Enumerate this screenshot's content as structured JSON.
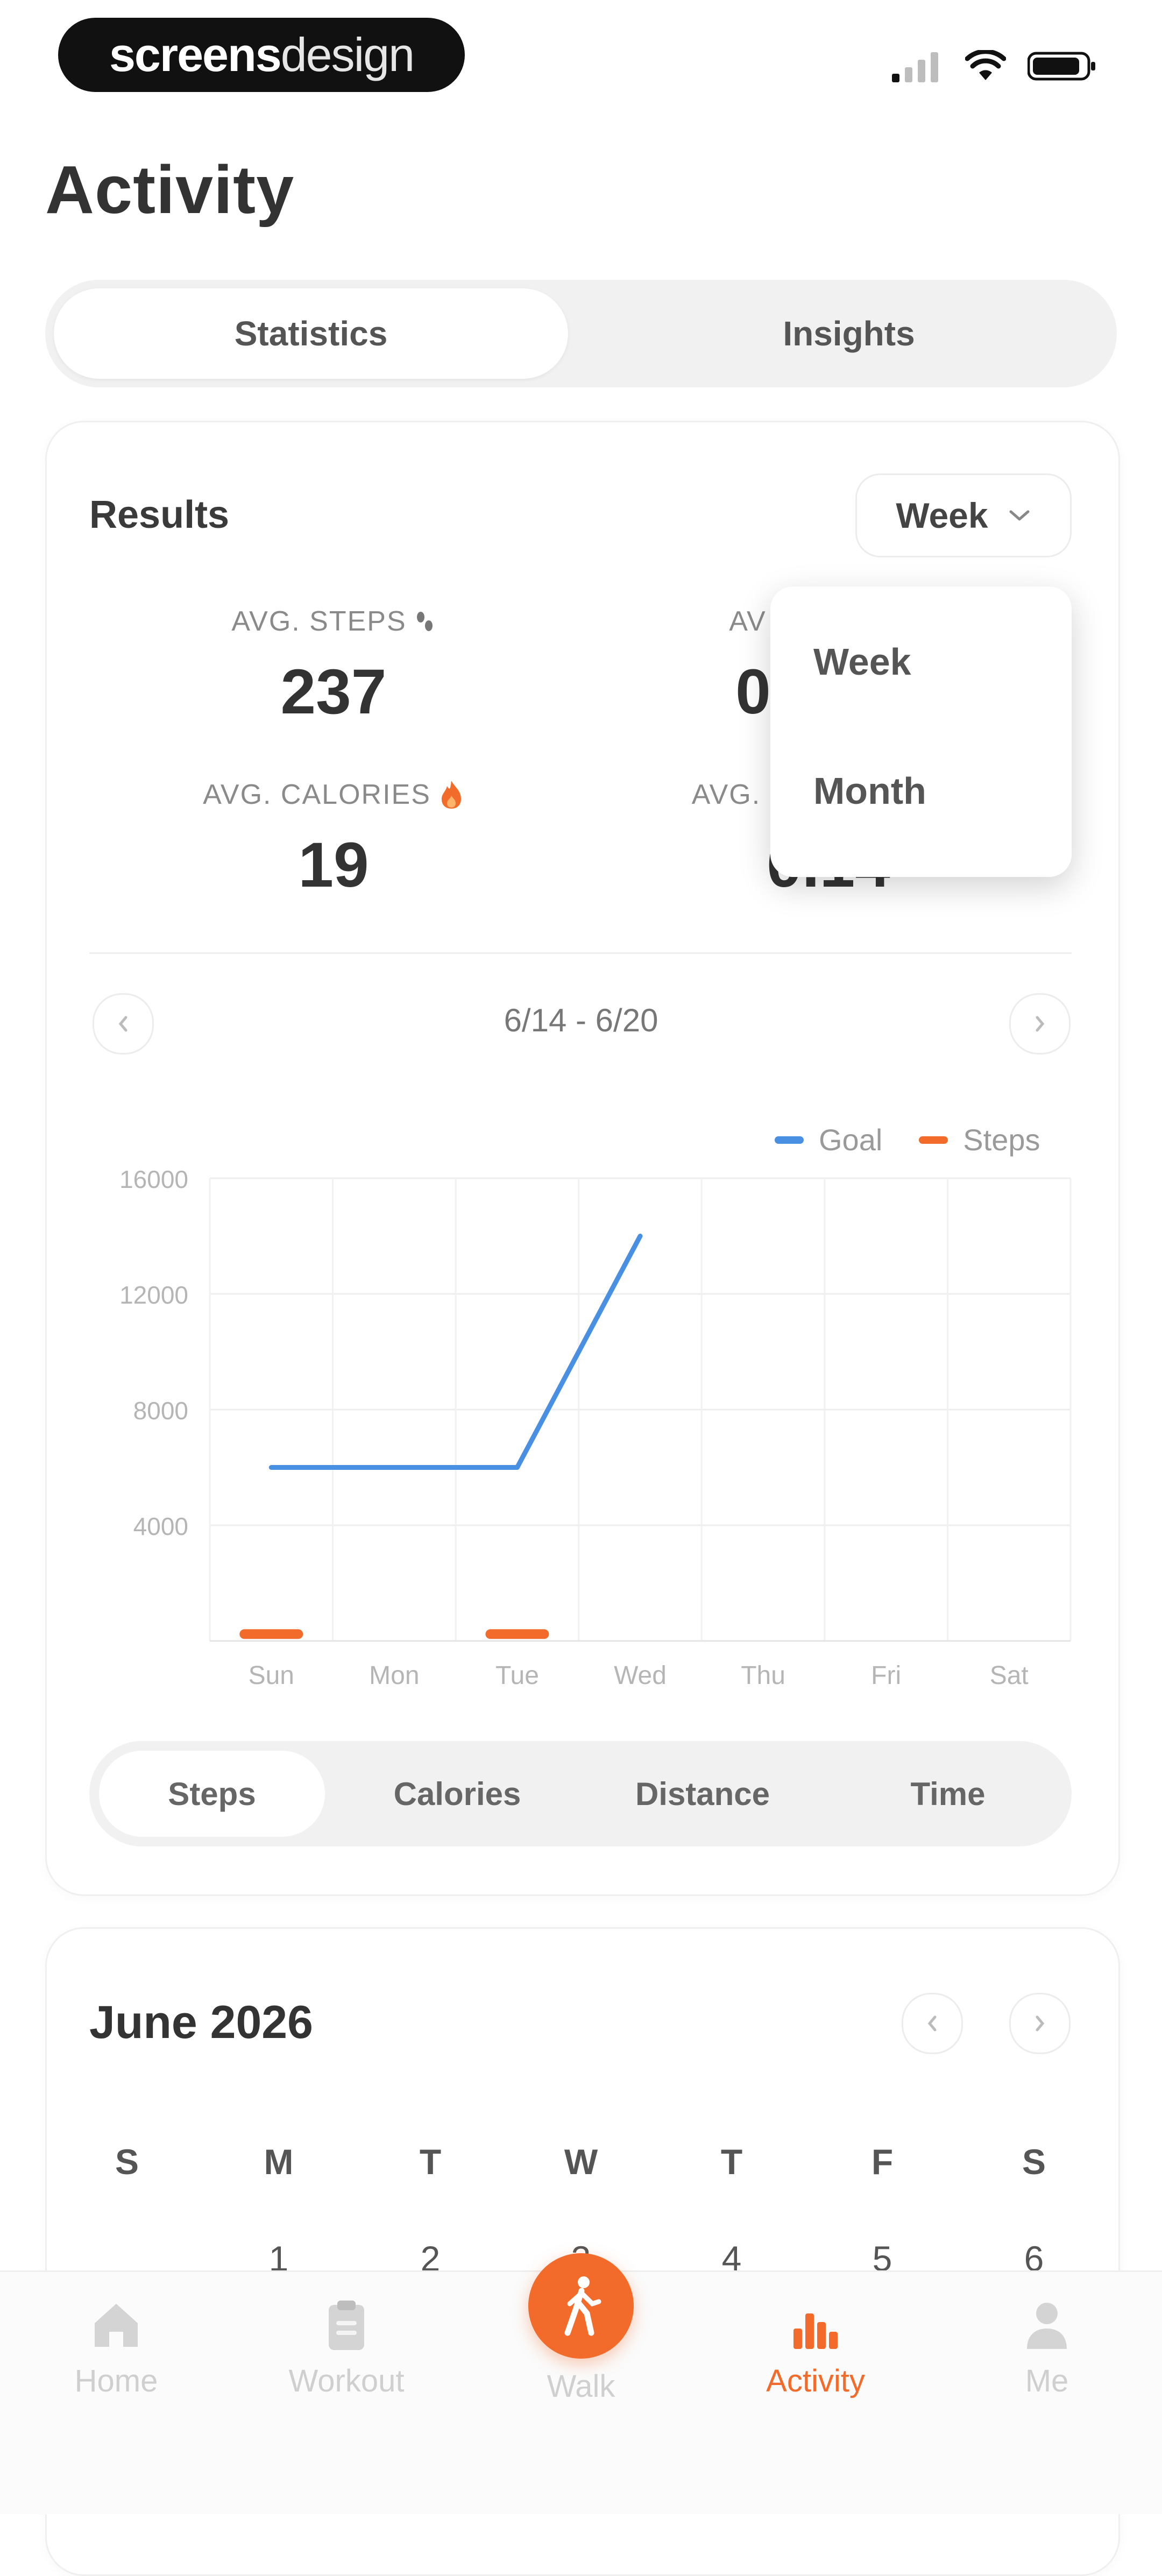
{
  "status_bar": {
    "brand_part1": "screens",
    "brand_part2": "design"
  },
  "header": {
    "title": "Activity"
  },
  "tabs": {
    "items": [
      "Statistics",
      "Insights"
    ],
    "active": "Statistics"
  },
  "results": {
    "title": "Results",
    "range_selected": "Week",
    "stats": [
      {
        "label": "AVG. STEPS",
        "value": "237",
        "icon": "footprint-icon"
      },
      {
        "label": "AV",
        "value": "0"
      },
      {
        "label": "AVG. CALORIES",
        "value": "19",
        "icon": "flame-icon"
      },
      {
        "label": "AVG.",
        "value": "0.14"
      }
    ],
    "dropdown_options": [
      "Week",
      "Month"
    ],
    "date_range": "6/14 - 6/20"
  },
  "colors": {
    "accent": "#f26b2a",
    "goal": "#4a90e2",
    "steps": "#f26b2a"
  },
  "chart_data": {
    "type": "line",
    "categories": [
      "Sun",
      "Mon",
      "Tue",
      "Wed",
      "Thu",
      "Fri",
      "Sat"
    ],
    "series": [
      {
        "name": "Goal",
        "values": [
          6000,
          6000,
          6000,
          14000,
          null,
          null,
          null
        ]
      },
      {
        "name": "Steps",
        "values": [
          237,
          null,
          237,
          null,
          null,
          null,
          null
        ]
      }
    ],
    "y_ticks": [
      "16000",
      "12000",
      "8000",
      "4000"
    ],
    "ylim": [
      0,
      16000
    ],
    "grid": true,
    "legend": "top-right"
  },
  "metric_tabs": {
    "items": [
      "Steps",
      "Calories",
      "Distance",
      "Time"
    ],
    "active": "Steps"
  },
  "calendar": {
    "title": "June 2026",
    "weekdays": [
      "S",
      "M",
      "T",
      "W",
      "T",
      "F",
      "S"
    ],
    "first_row": [
      "",
      "1",
      "2",
      "3",
      "4",
      "5",
      "6"
    ]
  },
  "bottom_nav": {
    "items": [
      {
        "label": "Home",
        "icon": "home-icon"
      },
      {
        "label": "Workout",
        "icon": "clipboard-icon"
      },
      {
        "label": "Walk",
        "icon": "walking-icon"
      },
      {
        "label": "Activity",
        "icon": "bar-chart-icon"
      },
      {
        "label": "Me",
        "icon": "person-icon"
      }
    ],
    "active": "Activity"
  }
}
